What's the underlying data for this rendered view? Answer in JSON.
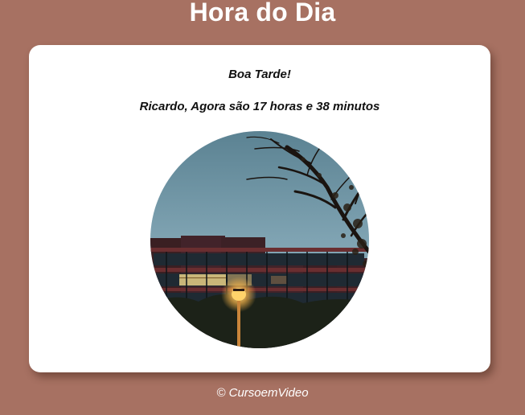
{
  "header": {
    "title": "Hora do Dia"
  },
  "card": {
    "greeting": "Boa Tarde!",
    "time_message": "Ricardo, Agora são 17 horas e 38 minutos",
    "photo": {
      "period": "afternoon",
      "sky_color": "#6f95a6"
    }
  },
  "footer": {
    "text": "© CursoemVideo"
  },
  "colors": {
    "background": "#a77162",
    "card": "#ffffff",
    "text": "#111111"
  }
}
